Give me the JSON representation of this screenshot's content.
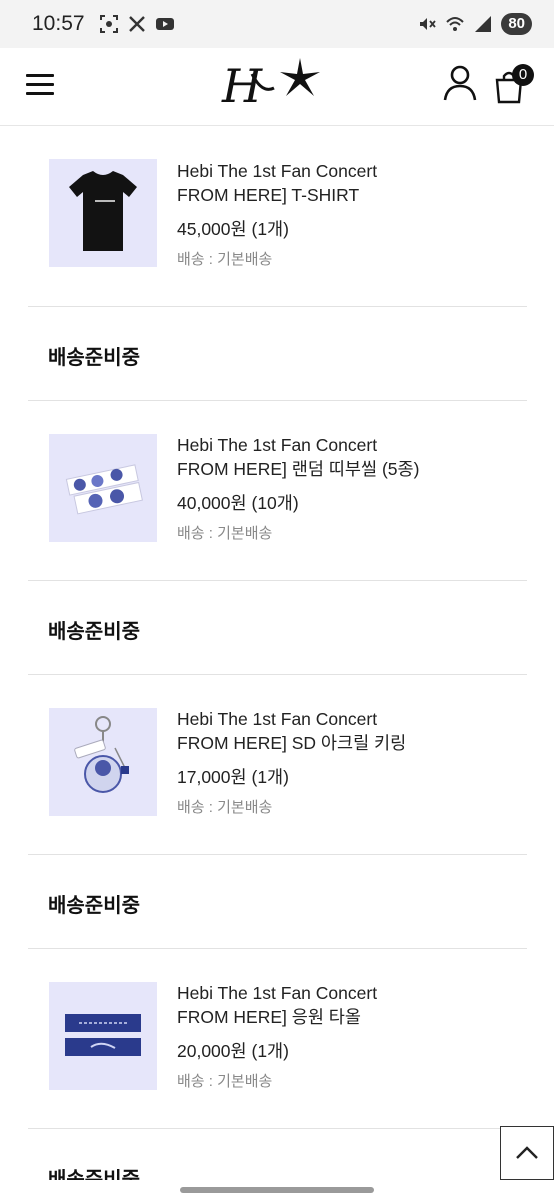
{
  "status_bar": {
    "time": "10:57",
    "left_icons": [
      "screenshot-icon",
      "x-icon",
      "youtube-icon"
    ],
    "right_icons": [
      "mute-icon",
      "wifi-icon",
      "signal-icon"
    ],
    "battery": "80"
  },
  "header": {
    "logo_text": "H",
    "cart_count": "0"
  },
  "orders": [
    {
      "title_line1": "Hebi The 1st Fan Concert",
      "title_line2": "FROM HERE] T-SHIRT",
      "price": "45,000원 (1개)",
      "shipping": "배송 : 기본배송",
      "thumb_bg": "#e6e6fa"
    },
    {
      "title_line1": "Hebi The 1st Fan Concert",
      "title_line2": "FROM HERE] 랜덤 띠부씰 (5종)",
      "price": "40,000원 (10개)",
      "shipping": "배송 : 기본배송",
      "thumb_bg": "#e6e6fa"
    },
    {
      "title_line1": "Hebi The 1st Fan Concert",
      "title_line2": "FROM HERE] SD 아크릴 키링",
      "price": "17,000원 (1개)",
      "shipping": "배송 : 기본배송",
      "thumb_bg": "#e6e6fa"
    },
    {
      "title_line1": "Hebi The 1st Fan Concert",
      "title_line2": "FROM HERE] 응원 타올",
      "price": "20,000원 (1개)",
      "shipping": "배송 : 기본배송",
      "thumb_bg": "#e6e6fa"
    }
  ],
  "section_labels": [
    "배송준비중",
    "배송준비중",
    "배송준비중",
    "배송준비중"
  ],
  "colors": {
    "thumb_bg": "#e6e6fa",
    "towel_blue": "#2a3a8c",
    "divider": "#e2e2e2"
  }
}
